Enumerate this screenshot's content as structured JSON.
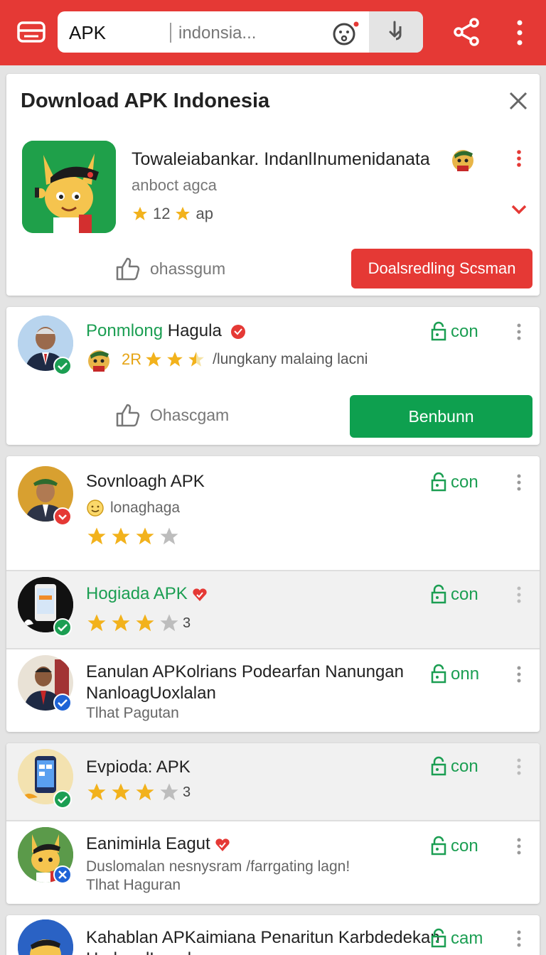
{
  "topbar": {
    "color": "#e53935",
    "search_prefix": "APK",
    "search_query": "indonsia...",
    "icons": [
      "menu-icon",
      "face-icon",
      "download-icon",
      "clipboard-icon",
      "share-icon",
      "more-icon"
    ]
  },
  "featured": {
    "title": "Download APK Indonesia",
    "app_name": "Towaleiabankar. IndanlInumenidanata",
    "subtitle": "anboct agca",
    "rating_value": "12",
    "rating_suffix": "ap",
    "like_label": "ohassgum",
    "download_label": "Doalsredling Scsman",
    "accent_color": "#e53935"
  },
  "card2": {
    "name_green": "Ponmlong",
    "name_rest": "Hagula",
    "rating_text": "2R",
    "stars": 2.5,
    "meta": "/lungkany malaing lacni",
    "link_label": "con",
    "like_label": "Ohascgam",
    "button_label": "Benbunn",
    "button_color": "#0ea04f"
  },
  "list": [
    {
      "title": "Sovnloagh APK",
      "subtitle": "lonaghaga",
      "stars": 3,
      "link_label": "con"
    },
    {
      "title": "Hogiada APK",
      "stars": 3,
      "star_count": "3",
      "link_label": "con"
    },
    {
      "title_line1": "Eanulan APKolrians Podearfan Nanungan",
      "title_line2": "NanloagUoxlalan",
      "subtitle": "Tlhat Pagutan",
      "link_label": "onn"
    },
    {
      "title": "Evpioda: APK",
      "stars": 3,
      "star_count": "3",
      "link_label": "con"
    },
    {
      "title": "Eanimінla Eagut",
      "subtitle_line1": "Duslomalan nesnysram /farrgating lagn!",
      "subtitle_line2": "Tlhat Haguran",
      "link_label": "con"
    },
    {
      "title_line1": "Kahablan APKaimiana Penaritun Karbdedekan",
      "title_line2": "HorlnoglLonalan",
      "link_label": "cam"
    }
  ]
}
